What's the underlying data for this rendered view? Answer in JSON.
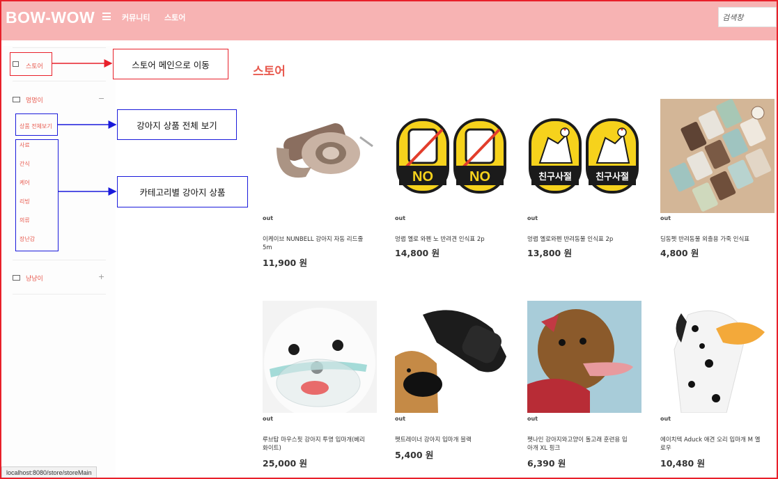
{
  "header": {
    "logo": "BOW-WOW",
    "nav": [
      "커뮤니티",
      "스토어"
    ],
    "search_placeholder": "검색창",
    "menu_icon": "hamburger-icon"
  },
  "sidebar": {
    "store_label": "스토어",
    "dog_label": "멍멍이",
    "dog_sign": "−",
    "dog_items": [
      "상품 전체보기",
      "사료",
      "간식",
      "케어",
      "리빙",
      "의류",
      "장난감"
    ],
    "cat_label": "냥냥이",
    "cat_sign": "+"
  },
  "annotations": {
    "store_main": "스토어 메인으로 이동",
    "all_products": "강아지 상품 전체 보기",
    "category": "카테고리별 강아지 상품"
  },
  "main": {
    "title": "스토어",
    "products": [
      {
        "status": "out",
        "name": "이케이브 NUNBELL 강아지 자동 리드줄 5m",
        "price": "11,900 원"
      },
      {
        "status": "out",
        "name": "멍랩 옐로 와펜 노 반려견 인식표 2p",
        "price": "14,800 원"
      },
      {
        "status": "out",
        "name": "멍랩 옐로와펜 반려동물 인식표 2p",
        "price": "13,800 원"
      },
      {
        "status": "out",
        "name": "딩동펫 반려동물 외출용 가죽 인식표",
        "price": "4,800 원"
      },
      {
        "status": "out",
        "name": "루브탑 마우스핏 강아지 투명 입마개(베리 화이트)",
        "price": "25,000 원"
      },
      {
        "status": "out",
        "name": "펫트레이너 강아지 입마개 블랙",
        "price": "5,400 원"
      },
      {
        "status": "out",
        "name": "펫나인 강아지와고양이 돌고래 훈련용 입아개 XL 핑크",
        "price": "6,390 원"
      },
      {
        "status": "out",
        "name": "에이치텍 Aduck 애견 오리 입마개 M 옐로우",
        "price": "10,480 원"
      }
    ],
    "badge_text": [
      "NO",
      "NO",
      "친구사절",
      "친구사절"
    ]
  },
  "statusbar": {
    "url": "localhost:8080/store/storeMain"
  }
}
